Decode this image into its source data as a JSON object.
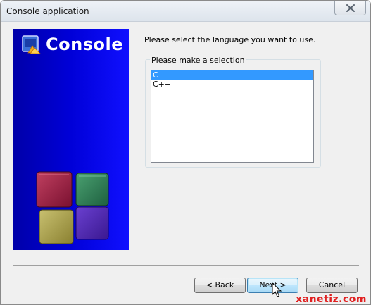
{
  "window": {
    "title": "Console application"
  },
  "side_panel": {
    "title": "Console",
    "background_color": "#0000d8"
  },
  "main": {
    "instruction": "Please select the language you want to use.",
    "group_label": "Please make a selection",
    "languages": [
      {
        "label": "C",
        "selected": true
      },
      {
        "label": "C++",
        "selected": false
      }
    ]
  },
  "buttons": {
    "back": "< Back",
    "next": "Next >",
    "cancel": "Cancel"
  },
  "watermark": "xanetiz.com",
  "colors": {
    "selection": "#3399ff",
    "watermark": "#e02020"
  },
  "icons": {
    "close": "close-icon",
    "logo": "console-logo-icon",
    "cursor": "mouse-pointer-icon"
  }
}
